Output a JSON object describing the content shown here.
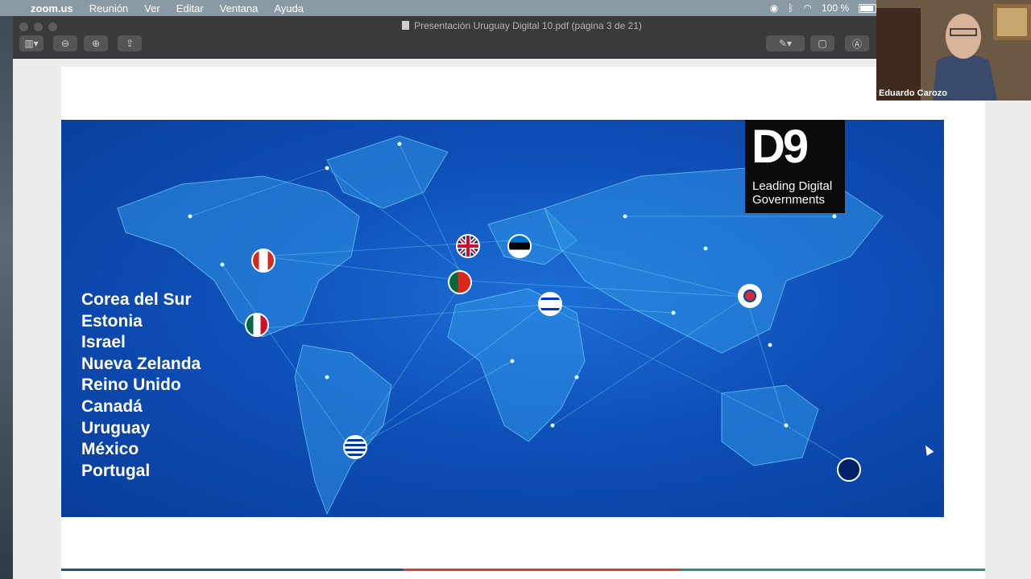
{
  "menubar": {
    "app": "zoom.us",
    "items": [
      "Reunión",
      "Ver",
      "Editar",
      "Ventana",
      "Ayuda"
    ],
    "battery": "100 %"
  },
  "window": {
    "title": "Presentación Uruguay Digital 10.pdf (página 3 de 21)"
  },
  "slide": {
    "logo_big": "D9",
    "logo_small_line1": "Leading Digital",
    "logo_small_line2": "Governments",
    "countries": [
      "Corea del Sur",
      "Estonia",
      "Israel",
      "Nueva Zelanda",
      "Reino Unido",
      "Canadá",
      "Uruguay",
      "México",
      "Portugal"
    ],
    "colors": {
      "map_blue": "#0e4fb8",
      "network": "#7fe3ff"
    }
  },
  "webcam": {
    "name": "Eduardo Carozo"
  }
}
